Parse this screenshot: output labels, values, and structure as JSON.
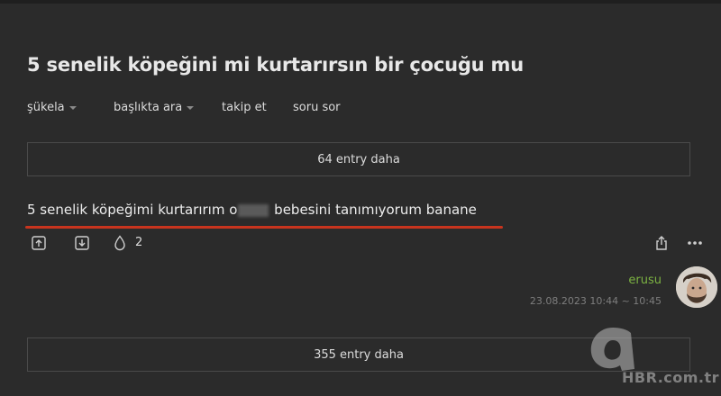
{
  "topic": {
    "title": "5 senelik köpeğini mi kurtarırsın bir çocuğu mu"
  },
  "nav": {
    "sort_label": "şükela",
    "search_label": "başlıkta ara",
    "follow_label": "takip et",
    "ask_label": "soru sor"
  },
  "more_top": {
    "label": "64 entry daha"
  },
  "entry": {
    "text_before": "5 senelik köpeğimi kurtarırım o",
    "text_after": " bebesini tanımıyorum banane",
    "favorite_count": "2",
    "author": "erusu",
    "date": "23.08.2023 10:44 ~ 10:45"
  },
  "more_bottom": {
    "label": "355 entry daha"
  },
  "icons": {
    "upvote": "arrow-up-box-icon",
    "downvote": "arrow-down-box-icon",
    "favorite": "drop-icon",
    "share": "share-icon",
    "more": "ellipsis-icon"
  },
  "colors": {
    "background": "#2b2b2b",
    "author": "#7cb342",
    "underline": "#c8341e"
  },
  "watermark": {
    "text": "HBR.com.tr"
  }
}
